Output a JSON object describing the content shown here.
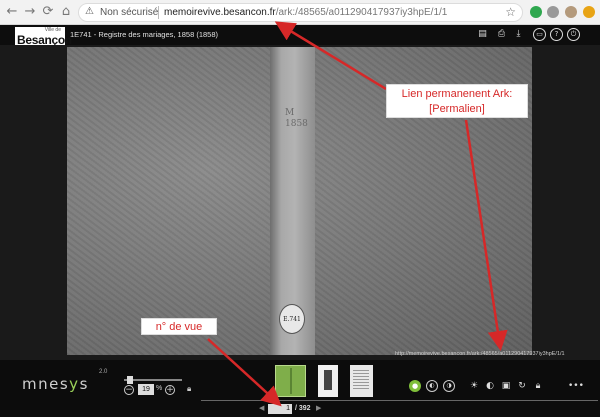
{
  "browser": {
    "security_label": "Non sécurisé",
    "url_host": "memoirevive.besancon.fr",
    "url_path": "/ark:/48565/a011290417937iy3hpE/1/1"
  },
  "header": {
    "logo_small": "Ville de",
    "logo_text": "Besançon",
    "document_title": "1E741 - Registre des mariages, 1858 (1858)"
  },
  "document": {
    "spine_text_line1": "M",
    "spine_text_line2": "1858",
    "spine_label": "E.741",
    "permalink": "http://memoirevive.besancon.fr/ark:/48565/a011290417937iy3hpE/1/1"
  },
  "toolbar": {
    "brand": "mnes",
    "brand_y": "y",
    "brand_end": "s",
    "brand_version": "2.0",
    "zoom_value": "19",
    "zoom_unit": "%",
    "current_page": "1",
    "total_pages": "/ 392"
  },
  "annotations": {
    "permalink_line1": "Lien permanenent Ark:",
    "permalink_line2": "[Permalien]",
    "view_number": "n° de vue",
    "color": "#d62828"
  }
}
